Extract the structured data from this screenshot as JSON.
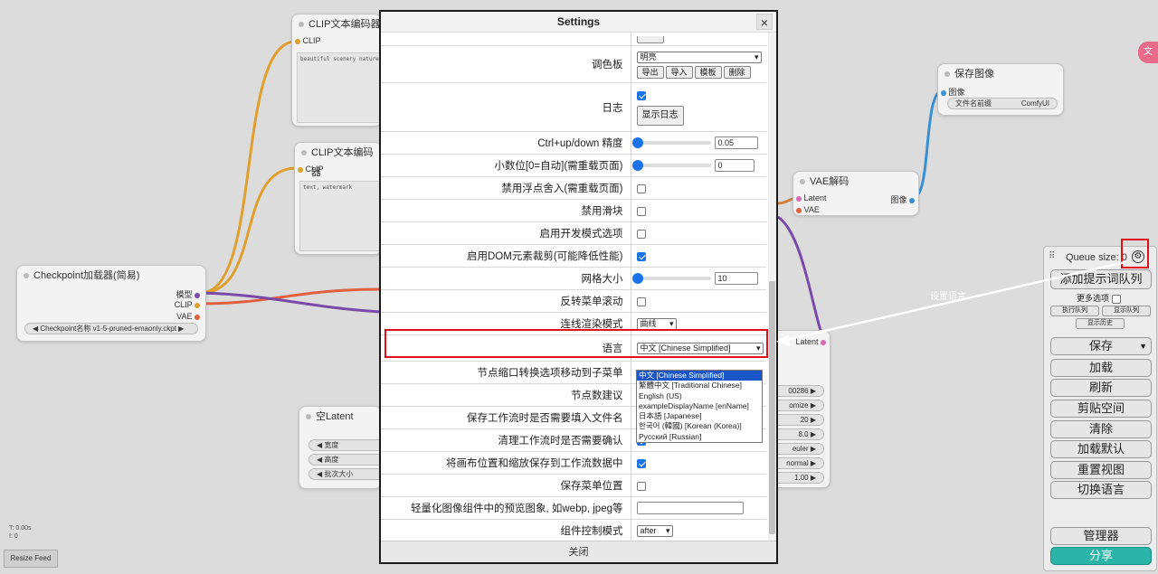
{
  "nodes": {
    "clip1": {
      "title": "CLIP文本编码器",
      "input": "CLIP",
      "text": "beautiful scenery nature gl"
    },
    "clip2": {
      "title": "CLIP文本编码器",
      "input": "CLIP",
      "text": "text, watermark"
    },
    "checkpoint": {
      "title": "Checkpoint加载器(简易)",
      "out_model": "模型",
      "out_clip": "CLIP",
      "out_vae": "VAE",
      "widget": "◀ Checkpoint名称  v1-5-pruned-emaonly.ckpt  ▶"
    },
    "save_image": {
      "title": "保存图像",
      "input": "图像",
      "widget_label": "文件名前缀",
      "widget_value": "ComfyUI"
    },
    "vae_decode": {
      "title": "VAE解码",
      "in_latent": "Latent",
      "in_vae": "VAE",
      "out_image": "图像"
    },
    "ksampler": {
      "out_latent": "Latent",
      "values": [
        "00286 ▶",
        "omize ▶",
        "20 ▶",
        "8.0 ▶",
        "euler ▶",
        "normal ▶",
        "1.00 ▶"
      ]
    },
    "empty_latent": {
      "title": "空Latent",
      "widgets": [
        "◀ 宽度",
        "◀ 高度",
        "◀ 批次大小"
      ]
    }
  },
  "canvas": {
    "info_lines": [
      "T: 0.00s",
      "I: 0"
    ],
    "resize_feed": "Resize Feed"
  },
  "queue_panel": {
    "title": "Queue size: 0",
    "add_button": "添加提示词队列",
    "more_options": "更多选项",
    "small_buttons": [
      "执行队列",
      "显示队列",
      "显示历史"
    ],
    "buttons": [
      "保存",
      "加载",
      "刷新",
      "剪贴空间",
      "清除",
      "加载默认",
      "重置视图",
      "切换语言"
    ],
    "manager": "管理器",
    "share": "分享"
  },
  "annotation": {
    "text": "设置语言"
  },
  "settings": {
    "title": "Settings",
    "close_icon": "×",
    "footer_close": "关闭",
    "palette": {
      "label": "调色板",
      "value": "明亮",
      "buttons": [
        "导出",
        "导入",
        "模板",
        "删除"
      ]
    },
    "log": {
      "label": "日志",
      "checked": true,
      "button": "显示日志"
    },
    "precision": {
      "label": "Ctrl+up/down 精度",
      "value": "0.05"
    },
    "decimals": {
      "label": "小数位[0=自动](需重载页面)",
      "value": "0"
    },
    "disable_float_round": {
      "label": "禁用浮点舍入(需重载页面)",
      "checked": false
    },
    "disable_slider": {
      "label": "禁用滑块",
      "checked": false
    },
    "dev_mode": {
      "label": "启用开发模式选项",
      "checked": false
    },
    "dom_clip": {
      "label": "启用DOM元素裁剪(可能降低性能)",
      "checked": true
    },
    "grid_size": {
      "label": "网格大小",
      "value": "10"
    },
    "invert_menu_scroll": {
      "label": "反转菜单滚动",
      "checked": false
    },
    "link_render": {
      "label": "连线渲染模式",
      "value": "曲线"
    },
    "language": {
      "label": "语言",
      "value": "中文 [Chinese Simplified]"
    },
    "node_slot_menu": {
      "label": "节点缩口转换选项移动到子菜单"
    },
    "node_suggest": {
      "label": "节点数建议"
    },
    "save_prompt": {
      "label": "保存工作流时是否需要填入文件名"
    },
    "clear_confirm": {
      "label": "清理工作流时是否需要确认",
      "checked": true
    },
    "save_canvas_pos": {
      "label": "将画布位置和缩放保存到工作流数据中",
      "checked": true
    },
    "save_menu_pos": {
      "label": "保存菜单位置",
      "checked": false
    },
    "preview_format": {
      "label": "轻量化图像组件中的预览图象, 如webp, jpeg等",
      "value": ""
    },
    "widget_control": {
      "label": "组件控制模式",
      "value": "after"
    },
    "language_options": [
      "中文 [Chinese Simplified]",
      "繁體中文 [Traditional Chinese]",
      "English (US)",
      "exampleDisplayName [enName]",
      "日本語 [Japanese]",
      "한국어 (韓國) [Korean (Korea)]",
      "Русский [Russian]"
    ]
  },
  "colors": {
    "accent": "#1a73e8",
    "highlight": "#e0101a",
    "wire_orange": "#e0a030",
    "wire_purple": "#7a4aa8",
    "wire_blue": "#3a90d0",
    "share": "#2bb5a8"
  }
}
